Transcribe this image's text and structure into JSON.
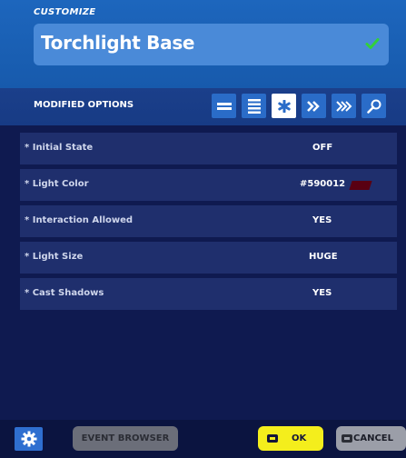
{
  "header": {
    "label": "CUSTOMIZE",
    "title": "Torchlight Base",
    "confirm_icon": "checkmark-icon"
  },
  "options": {
    "title": "MODIFIED OPTIONS",
    "filters": [
      {
        "icon": "lines-icon",
        "active": false
      },
      {
        "icon": "list-icon",
        "active": false
      },
      {
        "icon": "asterisk-icon",
        "active": true
      },
      {
        "icon": "double-chevron-icon",
        "active": false
      },
      {
        "icon": "triple-chevron-icon",
        "active": false
      },
      {
        "icon": "search-icon",
        "active": false
      }
    ],
    "rows": [
      {
        "label": "Initial State",
        "value": "OFF"
      },
      {
        "label": "Light Color",
        "value": "#590012",
        "swatch": "#590012"
      },
      {
        "label": "Interaction Allowed",
        "value": "YES"
      },
      {
        "label": "Light Size",
        "value": "HUGE"
      },
      {
        "label": "Cast Shadows",
        "value": "YES"
      }
    ],
    "modified_marker": "*"
  },
  "footer": {
    "settings_icon": "gear-icon",
    "event_browser": "EVENT BROWSER",
    "ok": "OK",
    "cancel": "CANCEL"
  },
  "colors": {
    "accent": "#1d66bd",
    "ok_yellow": "#f4ee1c",
    "confirm_green": "#32d03a"
  }
}
